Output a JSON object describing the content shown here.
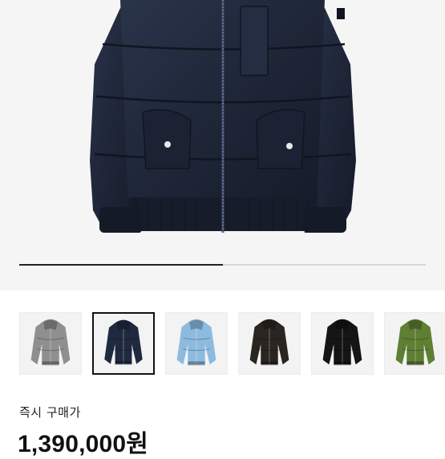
{
  "product": {
    "price_label": "즉시 구매가",
    "price_value": "1,390,000원"
  },
  "gallery": {
    "image_progress_percent": 50,
    "selected_index": 1,
    "thumbnails": [
      {
        "color": "#8f8f8f",
        "icon": "jacket-gray-icon"
      },
      {
        "color": "#1f2a40",
        "icon": "jacket-navy-icon"
      },
      {
        "color": "#8dbbe0",
        "icon": "jacket-light-blue-icon"
      },
      {
        "color": "#2a2520",
        "icon": "jacket-dark-brown-icon"
      },
      {
        "color": "#151515",
        "icon": "jacket-black-icon"
      },
      {
        "color": "#5f7f33",
        "icon": "jacket-olive-icon"
      }
    ]
  },
  "colors": {
    "hero_jacket": "#1e2638",
    "hero_background": "#f5f5f5",
    "progress_fill": "#222222",
    "progress_track": "#d6d6d6"
  }
}
